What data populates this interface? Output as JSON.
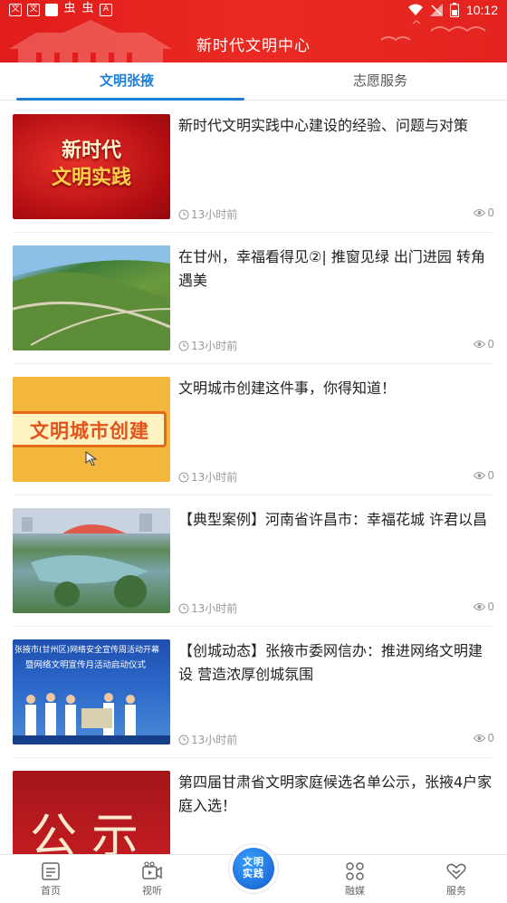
{
  "status_bar": {
    "time": "10:12",
    "battery": "2"
  },
  "header": {
    "title": "新时代文明中心"
  },
  "tabs": [
    {
      "label": "文明张掖",
      "active": true
    },
    {
      "label": "志愿服务",
      "active": false
    }
  ],
  "articles": [
    {
      "title": "新时代文明实践中心建设的经验、问题与对策",
      "time": "13小时前",
      "views": "0",
      "thumb_text": [
        "新时代",
        "文明实践"
      ]
    },
    {
      "title": "在甘州，幸福看得见②|  推窗见绿  出门进园 转角遇美",
      "time": "13小时前",
      "views": "0"
    },
    {
      "title": "文明城市创建这件事，你得知道！",
      "time": "13小时前",
      "views": "0",
      "thumb_text": [
        "文明城市创建"
      ]
    },
    {
      "title": "【典型案例】河南省许昌市：幸福花城  许君以昌",
      "time": "13小时前",
      "views": "0"
    },
    {
      "title": "【创城动态】张掖市委网信办：推进网络文明建设  营造浓厚创城氛围",
      "time": "13小时前",
      "views": "0",
      "thumb_text": [
        "张掖市(甘州区)网络安全宣传周活动开幕",
        "暨网络文明宣传月活动启动仪式"
      ]
    },
    {
      "title": "第四届甘肃省文明家庭候选名单公示，张掖4户家庭入选！",
      "time": "",
      "views": "",
      "thumb_text": [
        "公示"
      ]
    }
  ],
  "bottom_nav": {
    "items": [
      {
        "label": "首页"
      },
      {
        "label": "视听"
      },
      {
        "label": "融媒"
      },
      {
        "label": "服务"
      }
    ],
    "center_label": [
      "文明",
      "实践"
    ]
  },
  "colors": {
    "brand_red": "#e11c1c",
    "accent_blue": "#1e7fd9"
  }
}
